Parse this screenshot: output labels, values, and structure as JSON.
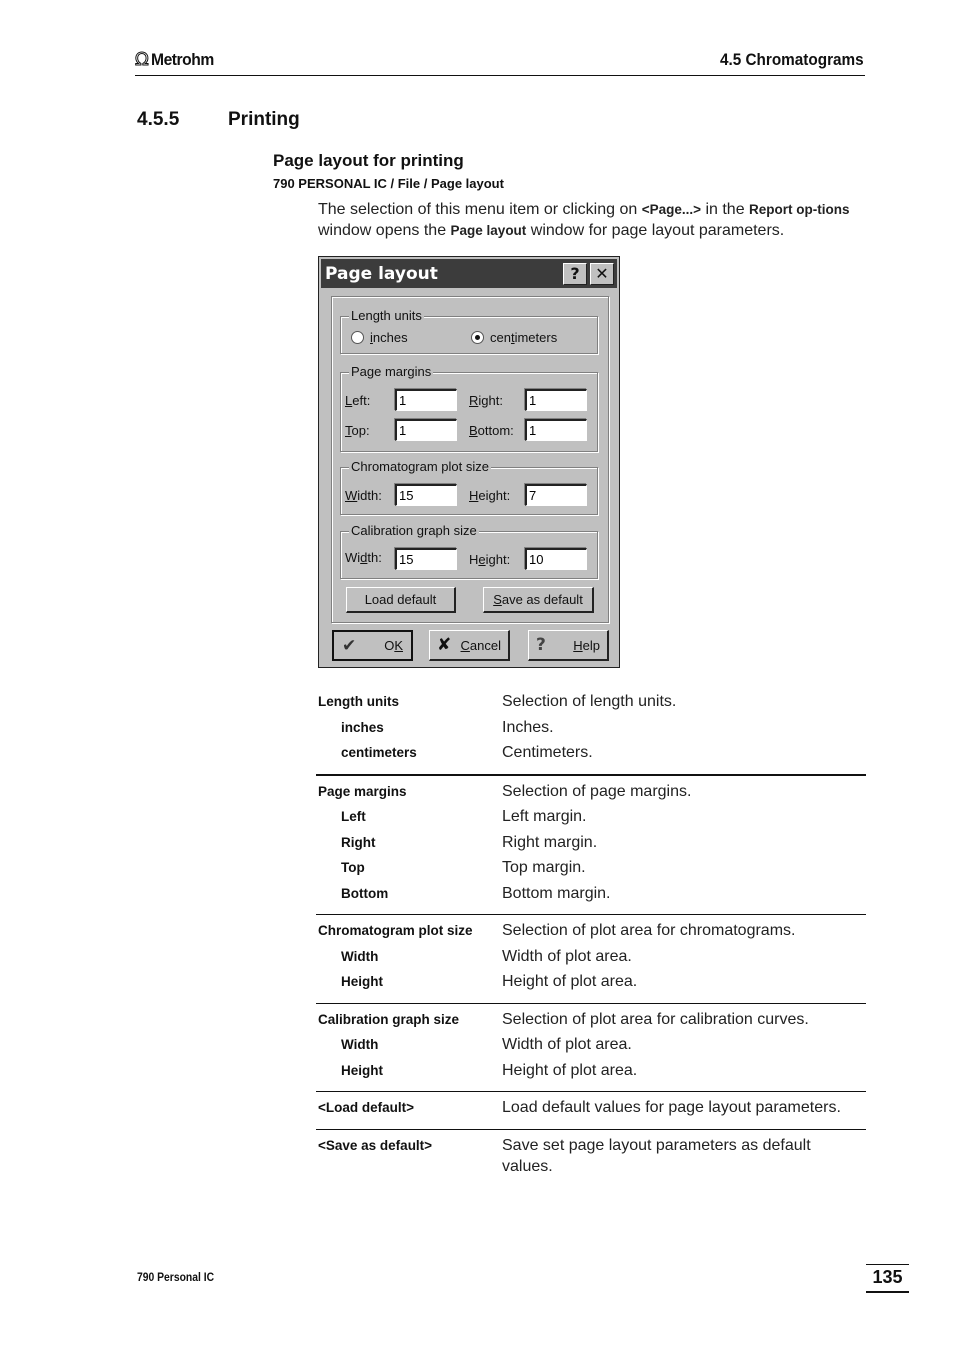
{
  "header": {
    "logo_text": "Metrohm",
    "logo_icon": "omega-icon",
    "section": "4.5  Chromatograms"
  },
  "section": {
    "number": "4.5.5",
    "title": "Printing"
  },
  "subsection": {
    "title": "Page layout for printing",
    "menu_path": "790 PERSONAL IC / File / Page layout",
    "intro": {
      "t1": "The selection of this menu item or clicking on ",
      "b1": "<Page...>",
      "t2": " in the ",
      "b2": "Report op-tions",
      "t3": " window opens the ",
      "b3": "Page layout",
      "t4": " window for page layout parameters."
    }
  },
  "dialog": {
    "title": "Page layout",
    "help_icon": "?",
    "close_icon": "✕",
    "length_units": {
      "legend": "Length units",
      "options": [
        {
          "label": "inches",
          "checked": false
        },
        {
          "label": "centimeters",
          "checked": true
        }
      ]
    },
    "page_margins": {
      "legend": "Page margins",
      "left_label": "Left:",
      "left_value": "1",
      "right_label": "Right:",
      "right_value": "1",
      "top_label": "Top:",
      "top_value": "1",
      "bottom_label": "Bottom:",
      "bottom_value": "1"
    },
    "chromatogram_plot": {
      "legend": "Chromatogram plot size",
      "width_label": "Width:",
      "width_value": "15",
      "height_label": "Height:",
      "height_value": "7"
    },
    "calibration_graph": {
      "legend": "Calibration graph size",
      "width_label": "Width:",
      "width_value": "15",
      "height_label": "Height:",
      "height_value": "10"
    },
    "load_default_label": "Load default",
    "save_default_label": "Save as default",
    "ok_label": "OK",
    "cancel_label": "Cancel",
    "help_label": "Help",
    "ok_icon": "✔",
    "cancel_icon": "✘",
    "help_btn_icon": "?"
  },
  "table": [
    {
      "rows": [
        {
          "key": "Length units",
          "value": "Selection of length units.",
          "sub": false
        },
        {
          "key": "inches",
          "value": "Inches.",
          "sub": true
        },
        {
          "key": "centimeters",
          "value": "Centimeters.",
          "sub": true
        }
      ]
    },
    {
      "rows": [
        {
          "key": "Page margins",
          "value": "Selection of page margins.",
          "sub": false
        },
        {
          "key": "Left",
          "value": "Left margin.",
          "sub": true
        },
        {
          "key": "Right",
          "value": "Right margin.",
          "sub": true
        },
        {
          "key": "Top",
          "value": "Top margin.",
          "sub": true
        },
        {
          "key": "Bottom",
          "value": "Bottom margin.",
          "sub": true
        }
      ]
    },
    {
      "rows": [
        {
          "key": "Chromatogram plot size",
          "value": "Selection of plot area for chromatograms.",
          "sub": false
        },
        {
          "key": "Width",
          "value": "Width of plot area.",
          "sub": true
        },
        {
          "key": "Height",
          "value": "Height of plot area.",
          "sub": true
        }
      ]
    },
    {
      "rows": [
        {
          "key": "Calibration graph size",
          "value": "Selection of plot area for calibration curves.",
          "sub": false
        },
        {
          "key": "Width",
          "value": "Width of plot area.",
          "sub": true
        },
        {
          "key": "Height",
          "value": "Height of plot area.",
          "sub": true
        }
      ]
    },
    {
      "rows": [
        {
          "key": "<Load default>",
          "value": "Load default values for page layout parameters.",
          "sub": false
        }
      ]
    },
    {
      "rows": [
        {
          "key": "<Save as default>",
          "value": "Save set page layout parameters as default values.",
          "sub": false
        }
      ]
    }
  ],
  "footer": {
    "product": "790 Personal IC",
    "page_number": "135"
  }
}
